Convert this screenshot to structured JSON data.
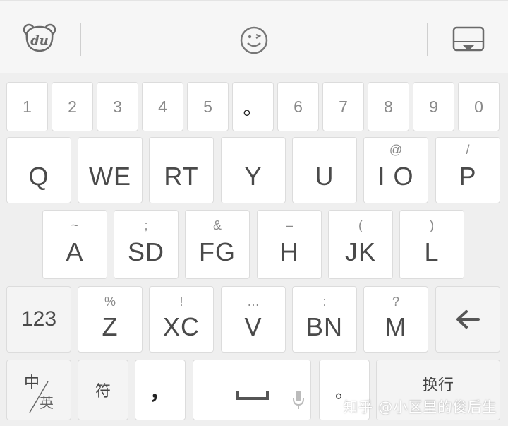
{
  "toolbar": {
    "logo_text": "du",
    "logo_icon": "bear-logo-icon",
    "emoji_icon": "smiley-wink-icon",
    "hide_icon": "keyboard-hide-icon"
  },
  "number_row": [
    "1",
    "2",
    "3",
    "4",
    "5",
    "。",
    "6",
    "7",
    "8",
    "9",
    "0"
  ],
  "row1": [
    {
      "main": "Q",
      "hint": ""
    },
    {
      "main": "WE",
      "hint": ""
    },
    {
      "main": "RT",
      "hint": ""
    },
    {
      "main": "Y",
      "hint": ""
    },
    {
      "main": "U",
      "hint": ""
    },
    {
      "main": "I O",
      "hint": "@"
    },
    {
      "main": "P",
      "hint": "/"
    }
  ],
  "row2": [
    {
      "main": "A",
      "hint": "~"
    },
    {
      "main": "SD",
      "hint": ";"
    },
    {
      "main": "FG",
      "hint": "&"
    },
    {
      "main": "H",
      "hint": "–"
    },
    {
      "main": "JK",
      "hint": "("
    },
    {
      "main": "L",
      "hint": ")"
    }
  ],
  "row3": {
    "mode_label": "123",
    "letters": [
      {
        "main": "Z",
        "hint": "%"
      },
      {
        "main": "XC",
        "hint": "!"
      },
      {
        "main": "V",
        "hint": "…"
      },
      {
        "main": "BN",
        "hint": ":"
      },
      {
        "main": "M",
        "hint": "?"
      }
    ],
    "backspace_icon": "backspace-arrow-icon"
  },
  "bottom_row": {
    "lang_top": "中",
    "lang_bottom": "英",
    "symbols": "符",
    "comma": "，",
    "space_icon": "space-bar-icon",
    "mic_icon": "microphone-icon",
    "period": "。",
    "enter": "换行"
  },
  "watermark": "知乎 @小区里的俊后生"
}
